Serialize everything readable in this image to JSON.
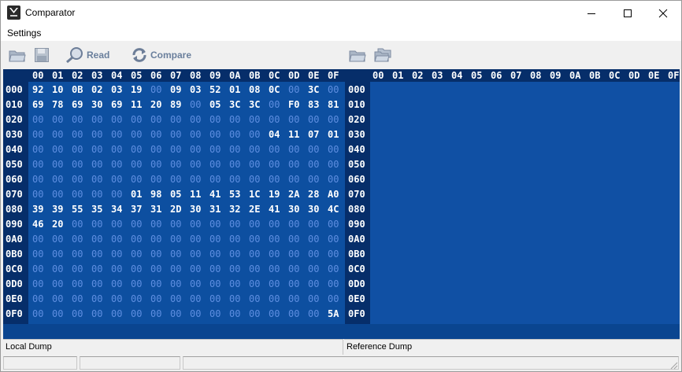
{
  "window": {
    "title": "Comparator"
  },
  "menu": {
    "settings": "Settings"
  },
  "toolbar": {
    "read": "Read",
    "compare": "Compare"
  },
  "colors": {
    "bg": "#0d4fa0",
    "header_bg": "#062e6a",
    "right_bg": "#1050a4",
    "value": "#ffffff",
    "zero": "#5e8ee0"
  },
  "hex": {
    "columns": [
      "00",
      "01",
      "02",
      "03",
      "04",
      "05",
      "06",
      "07",
      "08",
      "09",
      "0A",
      "0B",
      "0C",
      "0D",
      "0E",
      "0F"
    ],
    "offsets": [
      "000",
      "010",
      "020",
      "030",
      "040",
      "050",
      "060",
      "070",
      "080",
      "090",
      "0A0",
      "0B0",
      "0C0",
      "0D0",
      "0E0",
      "0F0"
    ],
    "rows": [
      [
        "92",
        "10",
        "0B",
        "02",
        "03",
        "19",
        "00",
        "09",
        "03",
        "52",
        "01",
        "08",
        "0C",
        "00",
        "3C",
        "00"
      ],
      [
        "69",
        "78",
        "69",
        "30",
        "69",
        "11",
        "20",
        "89",
        "00",
        "05",
        "3C",
        "3C",
        "00",
        "F0",
        "83",
        "81"
      ],
      [
        "00",
        "00",
        "00",
        "00",
        "00",
        "00",
        "00",
        "00",
        "00",
        "00",
        "00",
        "00",
        "00",
        "00",
        "00",
        "00"
      ],
      [
        "00",
        "00",
        "00",
        "00",
        "00",
        "00",
        "00",
        "00",
        "00",
        "00",
        "00",
        "00",
        "04",
        "11",
        "07",
        "01"
      ],
      [
        "00",
        "00",
        "00",
        "00",
        "00",
        "00",
        "00",
        "00",
        "00",
        "00",
        "00",
        "00",
        "00",
        "00",
        "00",
        "00"
      ],
      [
        "00",
        "00",
        "00",
        "00",
        "00",
        "00",
        "00",
        "00",
        "00",
        "00",
        "00",
        "00",
        "00",
        "00",
        "00",
        "00"
      ],
      [
        "00",
        "00",
        "00",
        "00",
        "00",
        "00",
        "00",
        "00",
        "00",
        "00",
        "00",
        "00",
        "00",
        "00",
        "00",
        "00"
      ],
      [
        "00",
        "00",
        "00",
        "00",
        "00",
        "01",
        "98",
        "05",
        "11",
        "41",
        "53",
        "1C",
        "19",
        "2A",
        "28",
        "A0"
      ],
      [
        "39",
        "39",
        "55",
        "35",
        "34",
        "37",
        "31",
        "2D",
        "30",
        "31",
        "32",
        "2E",
        "41",
        "30",
        "30",
        "4C"
      ],
      [
        "46",
        "20",
        "00",
        "00",
        "00",
        "00",
        "00",
        "00",
        "00",
        "00",
        "00",
        "00",
        "00",
        "00",
        "00",
        "00"
      ],
      [
        "00",
        "00",
        "00",
        "00",
        "00",
        "00",
        "00",
        "00",
        "00",
        "00",
        "00",
        "00",
        "00",
        "00",
        "00",
        "00"
      ],
      [
        "00",
        "00",
        "00",
        "00",
        "00",
        "00",
        "00",
        "00",
        "00",
        "00",
        "00",
        "00",
        "00",
        "00",
        "00",
        "00"
      ],
      [
        "00",
        "00",
        "00",
        "00",
        "00",
        "00",
        "00",
        "00",
        "00",
        "00",
        "00",
        "00",
        "00",
        "00",
        "00",
        "00"
      ],
      [
        "00",
        "00",
        "00",
        "00",
        "00",
        "00",
        "00",
        "00",
        "00",
        "00",
        "00",
        "00",
        "00",
        "00",
        "00",
        "00"
      ],
      [
        "00",
        "00",
        "00",
        "00",
        "00",
        "00",
        "00",
        "00",
        "00",
        "00",
        "00",
        "00",
        "00",
        "00",
        "00",
        "00"
      ],
      [
        "00",
        "00",
        "00",
        "00",
        "00",
        "00",
        "00",
        "00",
        "00",
        "00",
        "00",
        "00",
        "00",
        "00",
        "00",
        "5A"
      ]
    ]
  },
  "panes": {
    "local": "Local Dump",
    "reference": "Reference Dump"
  }
}
